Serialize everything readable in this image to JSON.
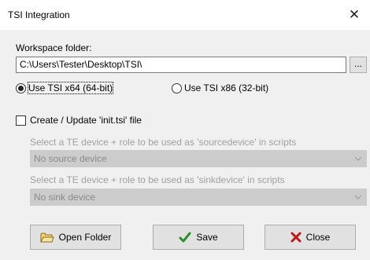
{
  "window": {
    "title": "TSI Integration",
    "close_glyph": "✕"
  },
  "workspace": {
    "label": "Workspace folder:",
    "path": "C:\\Users\\Tester\\Desktop\\TSI\\",
    "browse_label": "..."
  },
  "arch": {
    "x64_label": "Use TSI x64 (64-bit)",
    "x86_label": "Use TSI x86 (32-bit)",
    "selected": "x64"
  },
  "init_file": {
    "label": "Create / Update 'init.tsi' file",
    "checked": false
  },
  "source_device": {
    "label": "Select a TE device + role to be used as 'sourcedevice' in scripts",
    "value": "No source device"
  },
  "sink_device": {
    "label": "Select a TE device + role to be used as 'sinkdevice' in scripts",
    "value": "No sink device"
  },
  "buttons": {
    "open_folder": "Open Folder",
    "save": "Save",
    "close": "Close"
  },
  "icons": {
    "open_folder": "folder-icon",
    "save": "checkmark-icon",
    "close": "red-x-icon"
  },
  "colors": {
    "client_bg": "#f0f0f0",
    "disabled_text": "#a0a0a0",
    "disabled_combo": "#cccccc",
    "checkmark": "#2e8b2e",
    "close_x": "#c01818"
  }
}
